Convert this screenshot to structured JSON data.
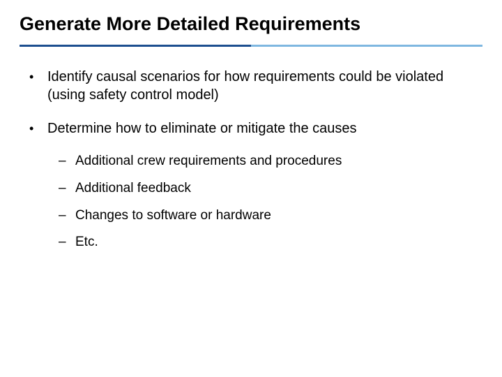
{
  "title": "Generate More Detailed Requirements",
  "bullets": [
    {
      "text": "Identify causal scenarios for how requirements could be violated (using safety control model)",
      "sub": []
    },
    {
      "text": "Determine how to eliminate or mitigate the causes",
      "sub": [
        "Additional crew requirements and procedures",
        "Additional feedback",
        "Changes to software or hardware",
        "Etc."
      ]
    }
  ]
}
